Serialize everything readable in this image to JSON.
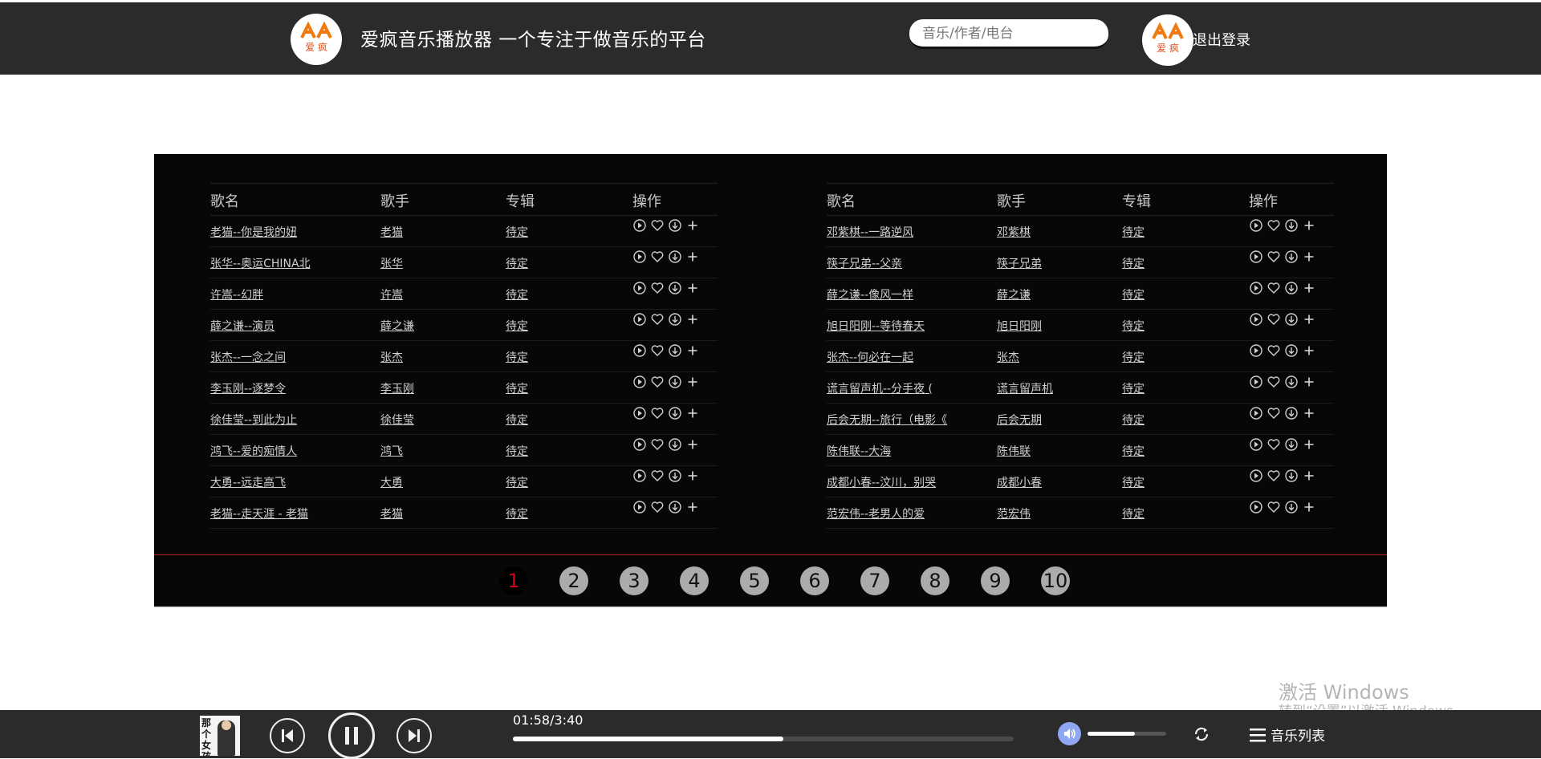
{
  "header": {
    "title": "爱疯音乐播放器  一个专注于做音乐的平台",
    "logo_text": "爱 疯",
    "search_placeholder": "音乐/作者/电台",
    "logout": "退出登录"
  },
  "columns": {
    "name": "歌名",
    "singer": "歌手",
    "album": "专辑",
    "ops": "操作"
  },
  "songs_left": [
    {
      "name": "老猫--你是我的妞",
      "singer": "老猫",
      "album": "待定"
    },
    {
      "name": "张华--奥运CHINA北",
      "singer": "张华",
      "album": "待定"
    },
    {
      "name": "许嵩--幻胖",
      "singer": "许嵩",
      "album": "待定"
    },
    {
      "name": "薛之谦--演员",
      "singer": "薛之谦",
      "album": "待定"
    },
    {
      "name": "张杰--一念之间",
      "singer": "张杰",
      "album": "待定"
    },
    {
      "name": "李玉刚--逐梦令",
      "singer": "李玉刚",
      "album": "待定"
    },
    {
      "name": "徐佳莹--到此为止",
      "singer": "徐佳莹",
      "album": "待定"
    },
    {
      "name": "鸿飞--爱的痴情人",
      "singer": "鸿飞",
      "album": "待定"
    },
    {
      "name": "大勇--远走高飞",
      "singer": "大勇",
      "album": "待定"
    },
    {
      "name": "老猫--走天涯 - 老猫",
      "singer": "老猫",
      "album": "待定"
    }
  ],
  "songs_right": [
    {
      "name": "邓紫棋--一路逆风",
      "singer": "邓紫棋",
      "album": "待定"
    },
    {
      "name": "筷子兄弟--父亲",
      "singer": "筷子兄弟",
      "album": "待定"
    },
    {
      "name": "薛之谦--像风一样",
      "singer": "薛之谦",
      "album": "待定"
    },
    {
      "name": "旭日阳刚--等待春天",
      "singer": "旭日阳刚",
      "album": "待定"
    },
    {
      "name": "张杰--何必在一起",
      "singer": "张杰",
      "album": "待定"
    },
    {
      "name": "谎言留声机--分手夜 (",
      "singer": "谎言留声机",
      "album": "待定"
    },
    {
      "name": "后会无期--旅行（电影《",
      "singer": "后会无期",
      "album": "待定"
    },
    {
      "name": "陈伟联--大海",
      "singer": "陈伟联",
      "album": "待定"
    },
    {
      "name": "成都小春--汶川，别哭",
      "singer": "成都小春",
      "album": "待定"
    },
    {
      "name": "范宏伟--老男人的爱",
      "singer": "范宏伟",
      "album": "待定"
    }
  ],
  "op_icons": [
    "play-circle-icon",
    "heart-icon",
    "download-icon",
    "plus-icon"
  ],
  "pages": [
    "1",
    "2",
    "3",
    "4",
    "5",
    "6",
    "7",
    "8",
    "9",
    "10"
  ],
  "active_page": "1",
  "player": {
    "cover_text": "那个女孩",
    "time": "01:58/3:40",
    "progress": 0.54,
    "volume": 0.6,
    "playlist_label": "音乐列表"
  },
  "watermark": {
    "line1": "激活 Windows",
    "line2": "转到“设置”以激活 Windows。"
  },
  "colors": {
    "header_bg": "#2b2b2b",
    "panel_bg": "#070707",
    "active_page": "#d0021b",
    "volume_icon": "#8fa6f2"
  }
}
